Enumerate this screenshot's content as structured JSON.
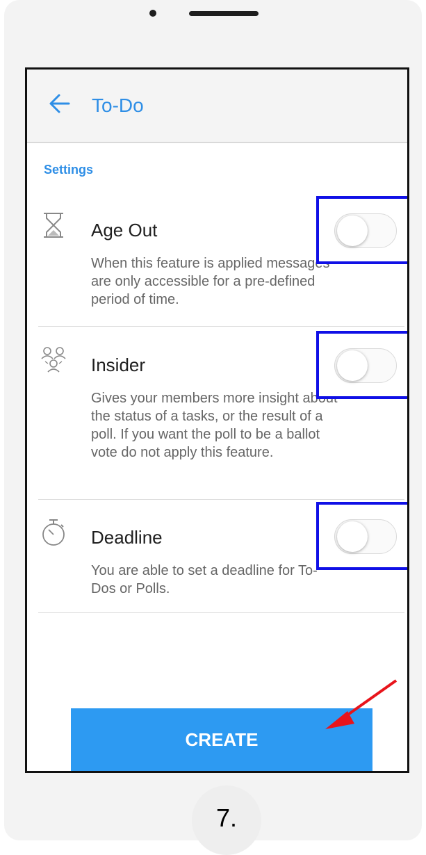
{
  "header": {
    "title": "To-Do"
  },
  "section_title": "Settings",
  "settings": [
    {
      "title": "Age Out",
      "description": "When this feature is applied messages are only accessible for a pre-defined period of time.",
      "icon": "hourglass-icon",
      "enabled": false
    },
    {
      "title": "Insider",
      "description": "Gives your members more insight about the status of a tasks, or the result of a poll. If you want the poll to be a ballot vote do not apply this feature.",
      "icon": "members-icon",
      "enabled": false
    },
    {
      "title": "Deadline",
      "description": "You are able to set a deadline for To-Dos or Polls.",
      "icon": "stopwatch-icon",
      "enabled": false
    }
  ],
  "create_button": "CREATE",
  "step_label": "7.",
  "colors": {
    "accent": "#2e8ee6",
    "button": "#2d9af2",
    "highlight": "#1010e6",
    "arrow": "#e8141b"
  }
}
